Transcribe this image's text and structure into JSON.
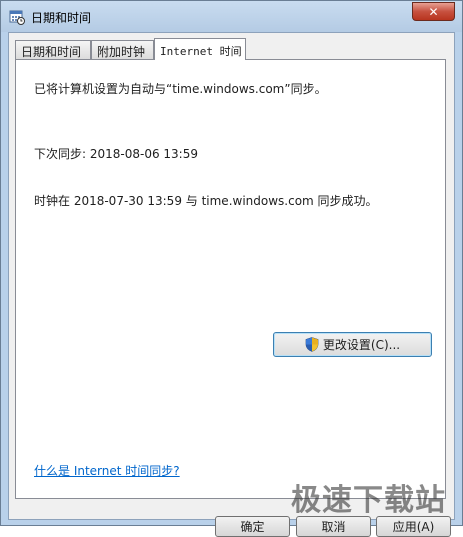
{
  "window": {
    "title": "日期和时间",
    "close_glyph": "✕"
  },
  "tabs": [
    {
      "label": "日期和时间",
      "active": false
    },
    {
      "label": "附加时钟",
      "active": false
    },
    {
      "label": "Internet 时间",
      "active": true
    }
  ],
  "panel": {
    "sync_setting_text": "已将计算机设置为自动与“time.windows.com”同步。",
    "next_sync_text": "下次同步: 2018-08-06 13:59",
    "last_sync_text": "时钟在 2018-07-30 13:59 与 time.windows.com 同步成功。",
    "change_settings_label": "更改设置(C)...",
    "help_link": "什么是 Internet 时间同步?"
  },
  "buttons": {
    "ok": "确定",
    "cancel": "取消",
    "apply": "应用(A)"
  },
  "watermark": "极速下载站",
  "colors": {
    "link": "#0066cc",
    "frame": "#b9d1ea",
    "close": "#c75140"
  },
  "icons": [
    "calendar-clock-icon",
    "close-icon",
    "uac-shield-icon"
  ]
}
